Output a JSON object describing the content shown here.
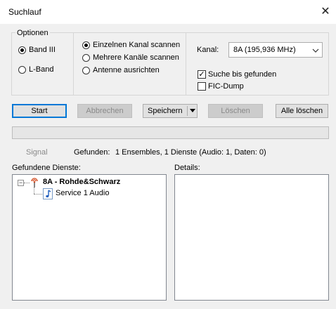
{
  "window": {
    "title": "Suchlauf",
    "close": "✕"
  },
  "optionen": {
    "label": "Optionen",
    "band3": "Band III",
    "lband": "L-Band",
    "band_selected": "Band III"
  },
  "scan_mode": {
    "single": "Einzelnen Kanal scannen",
    "multi": "Mehrere Kanäle scannen",
    "antenna": "Antenne ausrichten",
    "selected": "Einzelnen Kanal scannen"
  },
  "kanal": {
    "label": "Kanal:",
    "value": "8A (195,936 MHz)"
  },
  "checkboxes": {
    "search_until_found": {
      "label": "Suche bis gefunden",
      "checked": true
    },
    "fic_dump": {
      "label": "FIC-Dump",
      "checked": false
    }
  },
  "buttons": {
    "start": "Start",
    "abort": "Abbrechen",
    "save": "Speichern",
    "delete": "Löschen",
    "delete_all": "Alle löschen"
  },
  "progress": {
    "value_percent": 0
  },
  "status": {
    "signal_label": "Signal",
    "found_label": "Gefunden:",
    "found_value": "1 Ensembles, 1 Dienste (Audio: 1, Daten: 0)"
  },
  "services": {
    "label": "Gefundene Dienste:",
    "tree": {
      "ensemble": "8A - Rohde&Schwarz",
      "expander": "−",
      "children": [
        {
          "label": "Service 1 Audio"
        }
      ]
    }
  },
  "details": {
    "label": "Details:"
  },
  "icons": {
    "close": "close-icon",
    "dropdown": "chevron-down-icon",
    "ensemble": "antenna-icon",
    "service": "music-note-icon"
  },
  "colors": {
    "accent": "#0078d7",
    "progress": "#06b025"
  }
}
